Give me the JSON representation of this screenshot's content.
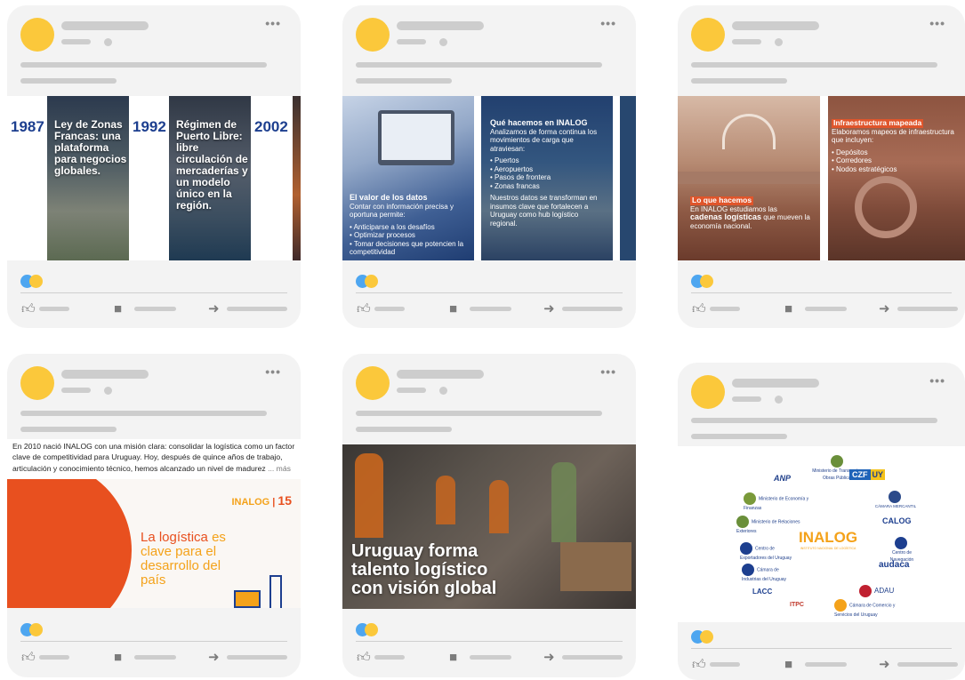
{
  "card_actions": {
    "more": "•••",
    "like_icon": "thumbs-up-icon",
    "comment_icon": "comment-icon",
    "share_icon": "share-arrow-icon"
  },
  "cards": {
    "c1": {
      "slides": [
        {
          "year": "1987",
          "text": "Ley de Zonas Francas: una plataforma para negocios globales."
        },
        {
          "year": "1992",
          "text": "Régimen de Puerto Libre: libre circulación de mercaderías y un modelo único en la región."
        },
        {
          "year": "2002",
          "text": ""
        }
      ]
    },
    "c2": {
      "slide1": {
        "title": "El valor de los datos",
        "body": "Contar con información precisa y oportuna permite:",
        "bullets": [
          "• Anticiparse a los desafíos",
          "• Optimizar procesos",
          "• Tomar decisiones que potencien la competitividad"
        ]
      },
      "slide2": {
        "title": "Qué hacemos en INALOG",
        "body": "Analizamos de forma continua los movimientos de carga que atraviesan:",
        "bullets": [
          "• Puertos",
          "• Aeropuertos",
          "• Pasos de frontera",
          "• Zonas francas"
        ],
        "footer": "Nuestros datos se transforman en insumos clave que fortalecen a Uruguay como hub logístico regional."
      }
    },
    "c3": {
      "slide1": {
        "tag": "Lo que hacemos",
        "line1": "En INALOG estudiamos las",
        "bold": "cadenas logísticas",
        "line2": "que mueven la economía nacional."
      },
      "slide2": {
        "tag": "Infraestructura mapeada",
        "body": "Elaboramos mapeos de infraestructura que incluyen:",
        "bullets": [
          "• Depósitos",
          "• Corredores",
          "• Nodos estratégicos"
        ]
      }
    },
    "c4": {
      "caption": "En 2010 nació INALOG con una misión clara: consolidar la logística como un factor clave de competitividad para Uruguay. Hoy, después de quince años de trabajo, articulación y conocimiento técnico, hemos alcanzado un nivel de madurez",
      "more": "... más",
      "logo_text": "INALOG",
      "logo_num": "15",
      "headline_accent": "La logística",
      "headline_rest1": "es",
      "headline_rest2": "clave para el",
      "headline_rest3": "desarrollo del",
      "headline_rest4": "país"
    },
    "c5": {
      "headline": [
        "Uruguay forma",
        "talento logístico",
        "con visión global"
      ]
    },
    "c6": {
      "center_logo": "INALOG",
      "center_sub": "INSTITUTO NACIONAL DE LOGÍSTICA",
      "partners": {
        "anp": "ANP",
        "mtop": "Ministerio de Transporte y Obras Públicas",
        "czf": "CZF",
        "czf_uy": "UY",
        "mef": "Ministerio de Economía y Finanzas",
        "cnc": "CÁMARA MERCANTIL",
        "mrree": "Ministerio de Relaciones Exteriores",
        "calog": "CALOG",
        "ceu": "Centro de Exportadores del Uruguay",
        "cn": "Centro de Navegación",
        "ciu": "Cámara de Industrias del Uruguay",
        "audaca": "audaca",
        "lacc": "LACC",
        "adau": "ADAU",
        "itpc": "ITPC",
        "ccsu": "Cámara de Comercio y Servicios del Uruguay"
      }
    }
  },
  "colors": {
    "avatar": "#fbc83b",
    "placeholder": "#cdcdcd",
    "card_bg": "#f3f3f3",
    "accent_orange": "#e8501f",
    "navy": "#1d3f8f",
    "like_blue": "#4ea6f0"
  }
}
